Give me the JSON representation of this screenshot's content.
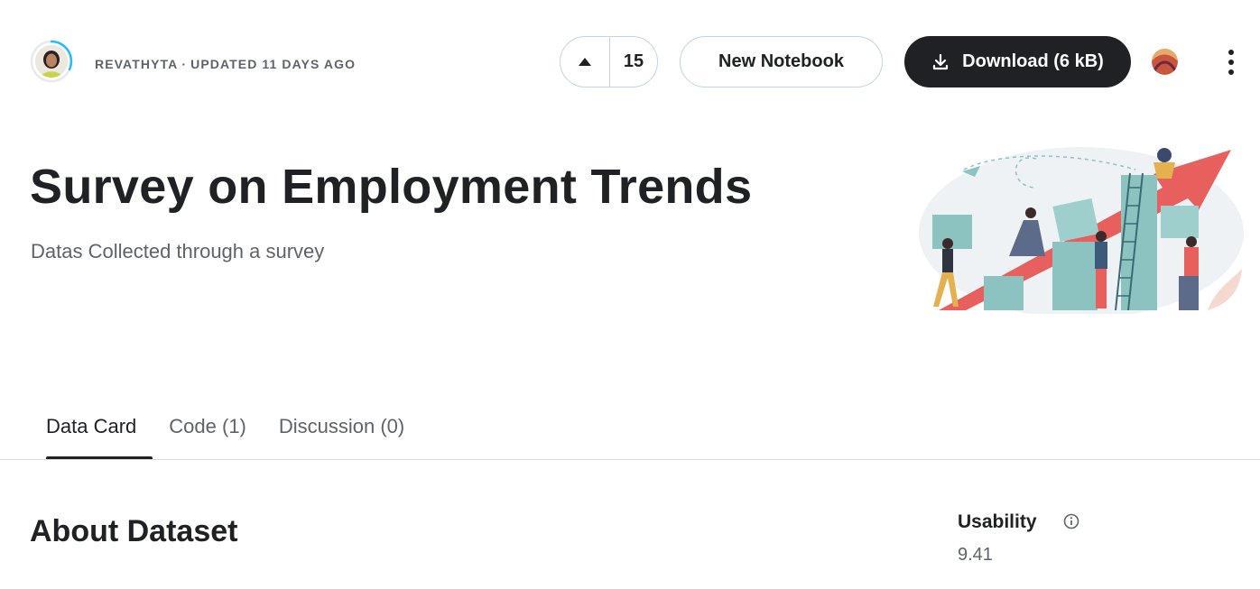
{
  "header": {
    "author": "REVATHYTA",
    "separator": "·",
    "updated": "UPDATED 11 DAYS AGO",
    "vote_count": "15",
    "new_notebook_label": "New Notebook",
    "download_label": "Download (6 kB)"
  },
  "dataset": {
    "title": "Survey on Employment Trends",
    "subtitle": "Datas Collected through a survey"
  },
  "tabs": [
    {
      "label": "Data Card",
      "active": true
    },
    {
      "label": "Code (1)",
      "active": false
    },
    {
      "label": "Discussion (0)",
      "active": false
    }
  ],
  "about": {
    "heading": "About Dataset",
    "usability_label": "Usability",
    "usability_value": "9.41"
  },
  "icons": {
    "vote": "triangle-up-icon",
    "download": "download-icon",
    "more": "more-vertical-icon",
    "info": "info-icon"
  },
  "colors": {
    "primary_dark": "#202124",
    "muted_text": "#5f6368",
    "outline": "#bfd7de",
    "ring_accent": "#20beff",
    "hero_teal": "#8cc2c0",
    "hero_red": "#e8605e"
  }
}
